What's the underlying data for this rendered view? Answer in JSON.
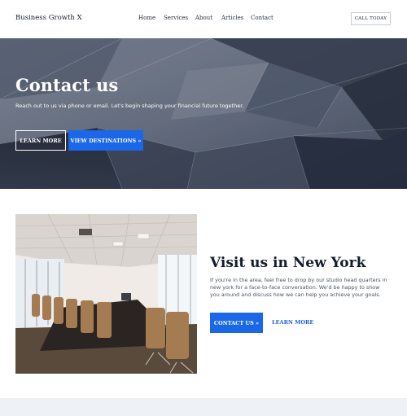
{
  "header": {
    "brand": "Business Growth X",
    "nav": [
      "Home",
      "Services",
      "About",
      "Articles",
      "Contact"
    ],
    "cta": "CALL TODAY"
  },
  "hero": {
    "title": "Contact us",
    "subtitle": "Reach out to us via phone or email. Let's begin shaping your financial future together.",
    "btn_learn": "LEARN MORE",
    "btn_destinations": "VIEW DESTINATIONS »"
  },
  "visit": {
    "title": "Visit us in New York",
    "text": "If you're in the area, feel free to drop by our studio head quarters in new york for a face-to-face conversation. We'd be happy to show you around and discuss how we can help you achieve your goals.",
    "btn_contact": "CONTACT US »",
    "link_learn": "LEARN MORE"
  },
  "colors": {
    "accent": "#1a67e8",
    "footer_band": "#eef2f7"
  }
}
